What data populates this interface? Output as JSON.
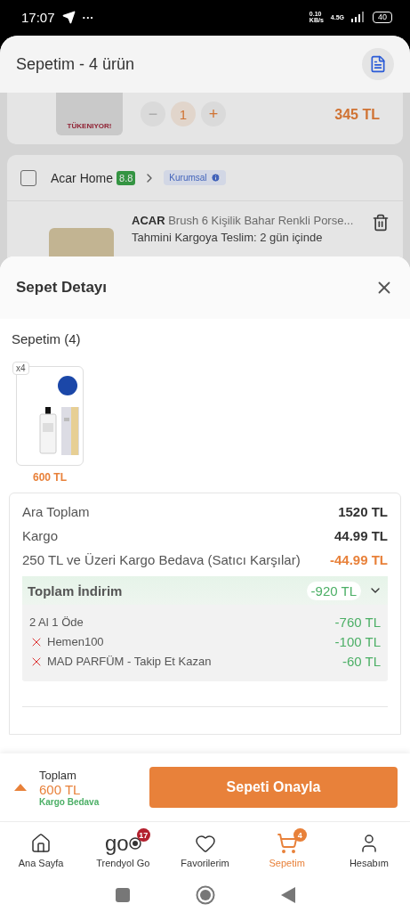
{
  "status_bar": {
    "time": "17:07",
    "more": "···",
    "speed": "0.10",
    "speed_unit": "KB/s",
    "network": "4.5G",
    "battery": "40"
  },
  "background": {
    "title": "Sepetim - 4 ürün",
    "first_item": {
      "stock_label": "TÜKENIYOR!",
      "minus": "−",
      "quantity": "1",
      "plus": "+",
      "price": "345 TL"
    },
    "seller": {
      "checked": false,
      "name": "Acar Home",
      "rating": "8.8",
      "tag": "Kurumsal",
      "product": {
        "title": "**ACAR** Brush 6 Kişilik Bahar Renkli Porse...",
        "delivery": "Tahmini Kargoya Teslim: 2 gün içinde"
      }
    }
  },
  "sheet": {
    "title": "Sepet Detayı",
    "basket_title": "Sepetim (4)",
    "items": [
      {
        "count": "x4",
        "price": "600 TL",
        "kind": "picture"
      }
    ],
    "summary": [
      {
        "label": "Ara Toplam",
        "value": "1520 TL",
        "kind": "normal"
      },
      {
        "label": "Kargo",
        "value": "44.99 TL",
        "kind": "normal"
      },
      {
        "label": "250 TL ve Üzeri Kargo Bedava (Satıcı Karşılar)",
        "value": "-44.99 TL",
        "kind": "discount"
      }
    ],
    "total_discount": {
      "label": "Toplam İndirim",
      "value": "-920 TL",
      "expanded": true,
      "items": [
        {
          "label": "2 Al 1 Öde",
          "value": "-760 TL",
          "crossed": false
        },
        {
          "label": "Hemen100",
          "value": "-100 TL",
          "crossed": true
        },
        {
          "label": "MAD PARFÜM - Takip Et Kazan",
          "value": "-60 TL",
          "crossed": true
        }
      ]
    }
  },
  "checkout": {
    "label": "Toplam",
    "total": "600 TL",
    "shipping": "Kargo Bedava",
    "button": "Sepeti Onayla"
  },
  "nav": [
    {
      "label": "Ana Sayfa",
      "kind": "home",
      "selected": false
    },
    {
      "label": "Trendyol Go",
      "kind": "go",
      "logo_text": "go",
      "badge": "17",
      "selected": false
    },
    {
      "label": "Favorilerim",
      "kind": "heart",
      "selected": false
    },
    {
      "label": "Sepetim",
      "kind": "cart",
      "badge": "4",
      "selected": true
    },
    {
      "label": "Hesabım",
      "kind": "user",
      "selected": false
    }
  ]
}
